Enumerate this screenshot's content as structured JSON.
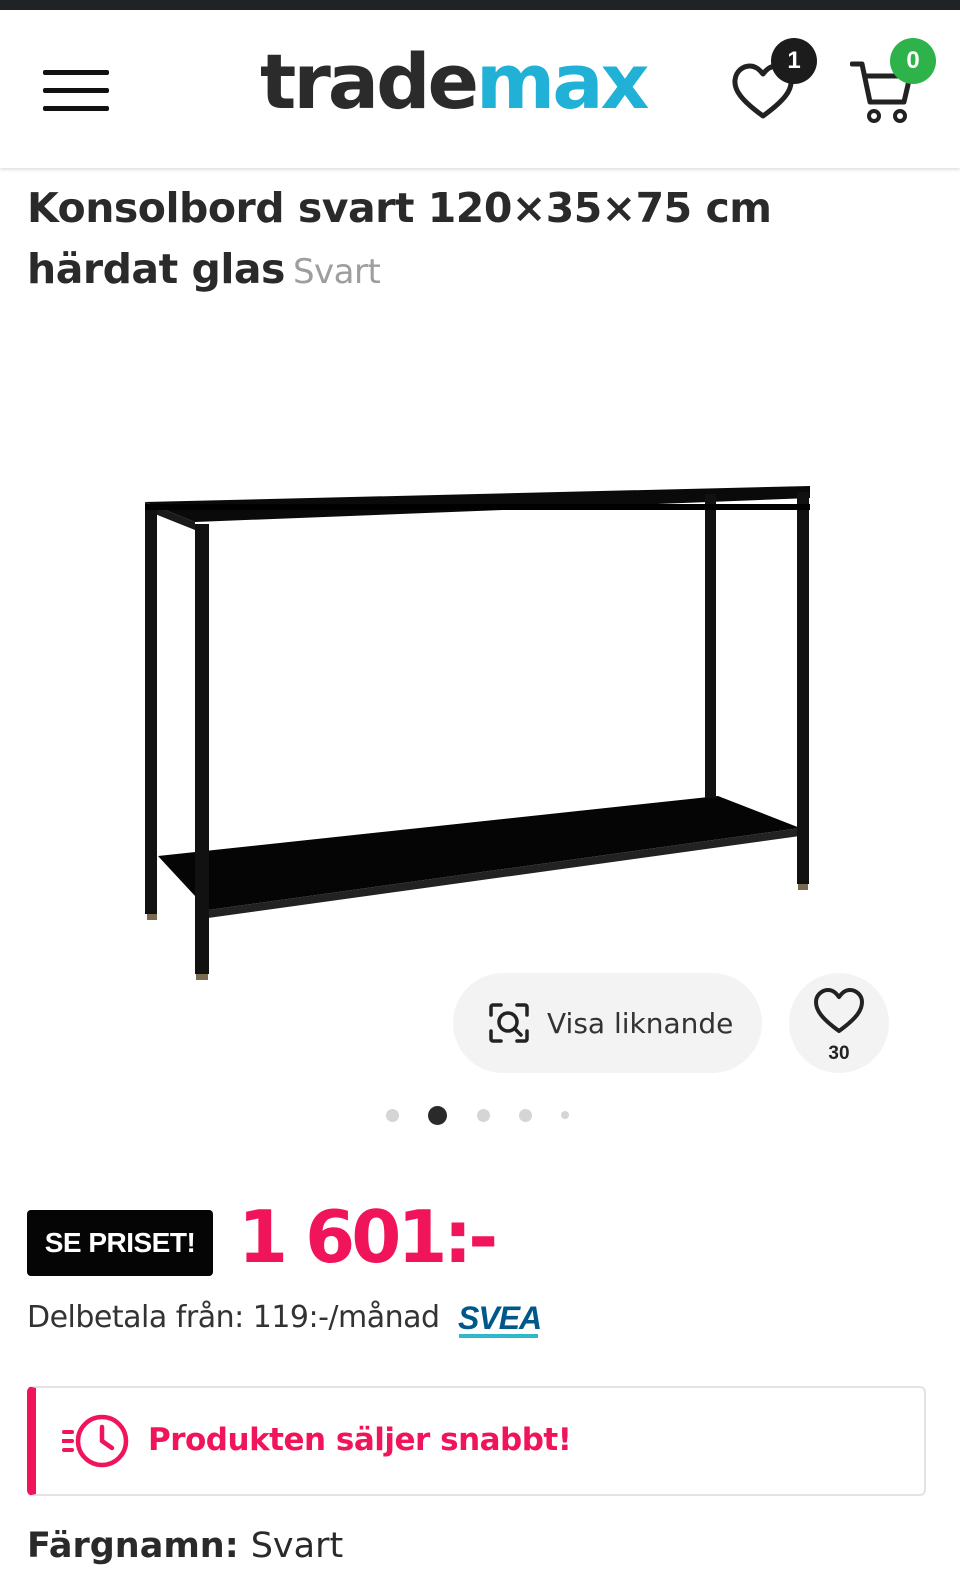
{
  "header": {
    "menu_icon": "hamburger-menu-icon",
    "logo": {
      "part1": "trade",
      "part2": "max"
    },
    "wishlist_count": "1",
    "cart_count": "0"
  },
  "product": {
    "title": "Konsolbord svart 120×35×75 cm härdat glas",
    "color_variant": "Svart",
    "image_alt": "console table",
    "similar_label": "Visa liknande",
    "favorites_count": "30",
    "gallery": {
      "total": 5,
      "active": 2
    }
  },
  "pricing": {
    "tag": "SE PRISET!",
    "price": "1 601:-",
    "installment": "Delbetala från: 119:-/månad",
    "provider": "SVEA"
  },
  "alert": {
    "text": "Produkten säljer snabbt!"
  },
  "attributes": {
    "color_label": "Färgnamn:",
    "color_value": "Svart"
  },
  "colors": {
    "accent_pink": "#f0145a",
    "brand_blue": "#21b1d6",
    "cart_green": "#2db34a"
  }
}
